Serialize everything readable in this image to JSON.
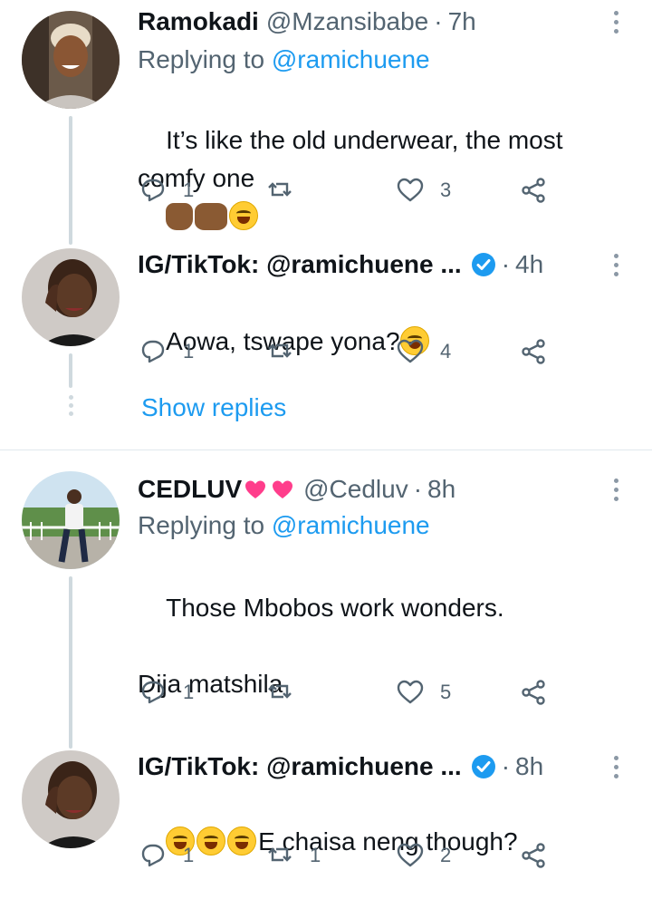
{
  "tweets": [
    {
      "name": "Ramokadi",
      "handle": "@Mzansibabe",
      "time": "7h",
      "replying_prefix": "Replying to",
      "replying_to": "@ramichuene",
      "text": "It’s like the old underwear, the most\ncomfy one",
      "emojis": [
        "fingers-crossed",
        "raising-hands",
        "rolling-laughing"
      ],
      "counts": {
        "reply": "1",
        "retweet": "",
        "like": "3"
      }
    },
    {
      "name": "IG/TikTok: @ramichuene ...",
      "verified": true,
      "time": "4h",
      "text": "Aowa, tswape yona?",
      "emojis": [
        "rolling-laughing"
      ],
      "counts": {
        "reply": "1",
        "retweet": "",
        "like": "4"
      }
    },
    {
      "name": "CEDLUV",
      "name_emojis": [
        "sparkling-heart",
        "sparkling-heart"
      ],
      "handle": "@Cedluv",
      "time": "8h",
      "replying_prefix": "Replying to",
      "replying_to": "@ramichuene",
      "text": "Those Mbobos work wonders.\n\nDija matshila",
      "counts": {
        "reply": "1",
        "retweet": "",
        "like": "5"
      }
    },
    {
      "name": "IG/TikTok: @ramichuene ...",
      "verified": true,
      "time": "8h",
      "text": "E chaisa neng though?",
      "emojis": [
        "rolling-laughing",
        "rolling-laughing",
        "rolling-laughing"
      ],
      "counts": {
        "reply": "1",
        "retweet": "1",
        "like": "2"
      }
    }
  ],
  "show_replies_label": "Show replies",
  "colors": {
    "accent": "#1d9bf0",
    "muted": "#536471",
    "line": "#cfd9de"
  }
}
